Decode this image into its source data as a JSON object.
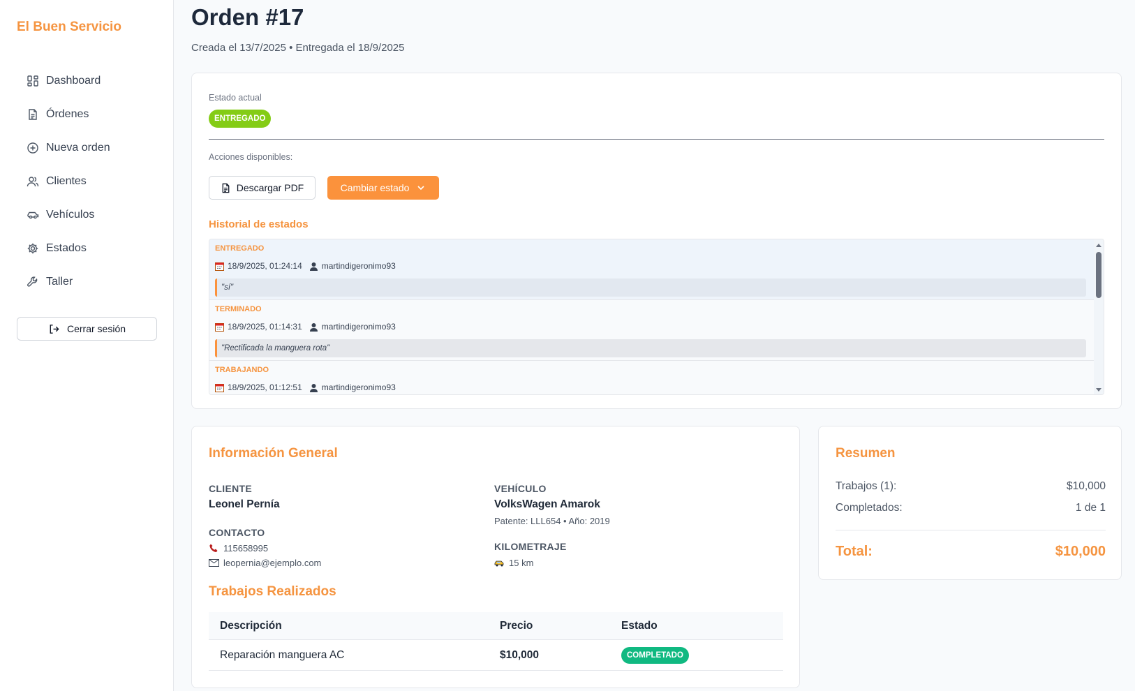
{
  "app": {
    "brand": "El Buen Servicio"
  },
  "sidebar": {
    "items": [
      {
        "label": "Dashboard",
        "icon": "dashboard-icon"
      },
      {
        "label": "Órdenes",
        "icon": "document-icon"
      },
      {
        "label": "Nueva orden",
        "icon": "plus-circle-icon"
      },
      {
        "label": "Clientes",
        "icon": "users-icon"
      },
      {
        "label": "Vehículos",
        "icon": "car-icon"
      },
      {
        "label": "Estados",
        "icon": "gear-icon"
      },
      {
        "label": "Taller",
        "icon": "wrench-icon"
      }
    ],
    "logout_label": "Cerrar sesión"
  },
  "header": {
    "title": "Orden #17",
    "subtitle": "Creada el 13/7/2025 • Entregada el 18/9/2025"
  },
  "status": {
    "current_label": "Estado actual",
    "current_badge": "ENTREGADO",
    "actions_label": "Acciones disponibles:",
    "download_label": "Descargar PDF",
    "change_label": "Cambiar estado",
    "history_title": "Historial de estados",
    "history": [
      {
        "state": "ENTREGADO",
        "datetime": "18/9/2025, 01:24:14",
        "user": "martindigeronimo93",
        "comment": "\"sí\""
      },
      {
        "state": "TERMINADO",
        "datetime": "18/9/2025, 01:14:31",
        "user": "martindigeronimo93",
        "comment": "\"Rectificada la manguera rota\""
      },
      {
        "state": "TRABAJANDO",
        "datetime": "18/9/2025, 01:12:51",
        "user": "martindigeronimo93",
        "comment": ""
      }
    ]
  },
  "info": {
    "title": "Información General",
    "client_label": "CLIENTE",
    "client_name": "Leonel Pernía",
    "contact_label": "CONTACTO",
    "phone": "115658995",
    "email": "leopernia@ejemplo.com",
    "vehicle_label": "VEHÍCULO",
    "vehicle_name": "VolksWagen Amarok",
    "vehicle_detail": "Patente: LLL654 • Año: 2019",
    "km_label": "KILOMETRAJE",
    "km_value": "15 km",
    "works_title": "Trabajos Realizados",
    "table": {
      "headers": [
        "Descripción",
        "Precio",
        "Estado"
      ],
      "rows": [
        {
          "description": "Reparación manguera AC",
          "price": "$10,000",
          "status": "COMPLETADO"
        }
      ]
    }
  },
  "summary": {
    "title": "Resumen",
    "works_label": "Trabajos (1):",
    "works_value": "$10,000",
    "completed_label": "Completados:",
    "completed_value": "1 de 1",
    "total_label": "Total:",
    "total_value": "$10,000"
  },
  "colors": {
    "accent": "#f59440",
    "delivered_badge": "#84cc16",
    "completed_badge": "#10b981"
  }
}
